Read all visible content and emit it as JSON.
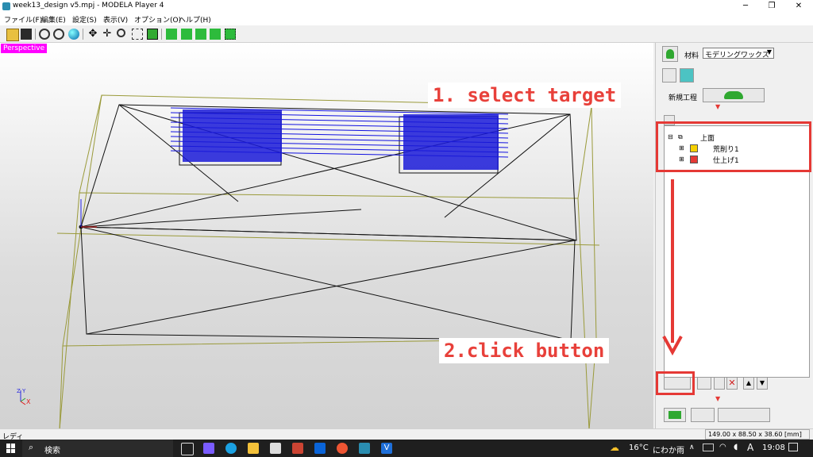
{
  "window": {
    "title": "week13_design v5.mpj - MODELA Player 4",
    "minimize": "─",
    "maximize": "❐",
    "close": "✕"
  },
  "menu": [
    "ファイル(F)",
    "編集(E)",
    "設定(S)",
    "表示(V)",
    "オプション(O)",
    "ヘルプ(H)"
  ],
  "toolbar_icons": [
    "open-icon",
    "save-icon",
    "rotate-icon",
    "view-icon",
    "sphere-icon",
    "move-icon",
    "pan-icon",
    "zoom-icon",
    "fit-icon",
    "zoom-box-icon",
    "model-icon",
    "tool-icon",
    "tool-path-icon",
    "material-icon",
    "layout-icon"
  ],
  "viewport": {
    "label": "Perspective",
    "axis_z": "Z Y",
    "axis_x": "X"
  },
  "annotations": {
    "step1": "1. select target",
    "step2": "2.click button"
  },
  "panel": {
    "material_label": "材料",
    "material_value": "モデリングワックス",
    "new_process_label": "新規工程",
    "tree": {
      "root": "上面",
      "items": [
        {
          "label": "荒削り1",
          "checked": true,
          "color": "#f5d000"
        },
        {
          "label": "仕上げ1",
          "checked": true,
          "color": "#e53935"
        }
      ]
    }
  },
  "statusbar": {
    "left": "レディ",
    "dims": "149.00 x 88.50 x 38.60 [mm]"
  },
  "taskbar": {
    "search": "検索",
    "weather": "16°C",
    "weather_desc": "にわか雨",
    "time": "19:08",
    "ime": "A"
  }
}
